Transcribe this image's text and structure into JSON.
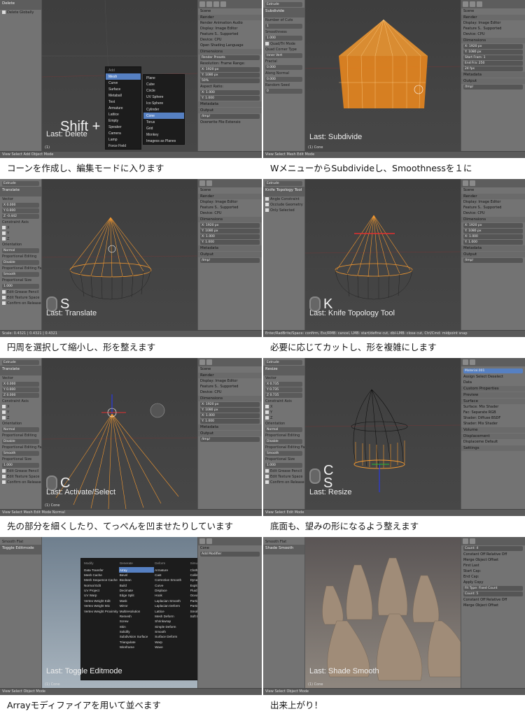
{
  "captions": [
    "コーンを作成し、編集モードに入ります",
    "WメニューからSubdivideし、Smoothnessを１に",
    "円周を選択して縮小し、形を整えます",
    "必要に応じてカットし、形を複雑にします",
    "先の部分を細くしたり、てっぺんを凹ませたりしています",
    "底面も、望みの形になるよう整えます",
    "Arrayモディファイアを用いて並べます",
    "出来上がり！"
  ],
  "panels": [
    {
      "last": "Last: Delete",
      "key": "Shift +",
      "left_header": "Delete",
      "left_items": [
        "Delete Globally"
      ],
      "obj": "(1)",
      "mode": "Object Mode"
    },
    {
      "last": "Last: Subdivide",
      "key": "",
      "left_header": "Subdivide",
      "left_items": [
        "Number of Cuts",
        "1",
        "Smoothness",
        "1.000",
        "Quad/Tri Mode",
        "Quad Corner Type",
        "Inner Vert",
        "Fractal",
        "0.000",
        "Along Normal",
        "0.000",
        "Random Seed",
        "0"
      ],
      "obj": "(1) Cone",
      "mode": "Edit Mode"
    },
    {
      "last": "Last: Translate",
      "key": "S",
      "left_header": "Translate",
      "left_items": [
        "Vector",
        "X 0.000",
        "Y 0.000",
        "Z -0.442",
        "Constraint Axis",
        "X",
        "Y",
        "Z",
        "Orientation",
        "Normal",
        "Proportional Editing",
        "Disable",
        "Proportional Editing Fall",
        "Smooth",
        "Proportional Size",
        "1.000",
        "Edit Grease Pencil",
        "Edit Texture Space",
        "Confirm on Release"
      ],
      "obj": "(1) Cone",
      "mode": "Edit Mode",
      "status": "Scale: 0.4321 | 0.4321 | 0.4321"
    },
    {
      "last": "Last: Knife Topology Tool",
      "key": "K",
      "left_header": "Knife Topology Tool",
      "left_items": [
        "Angle Constraint",
        "Occlude Geometry",
        "Only Selected"
      ],
      "obj": "(1) Cone",
      "mode": "Edit Mode",
      "status": "Enter/RadBrite/Space: confirm, Esc/RMB: cancel, LMB: start/define cut, dbl-LMB: close cut, Ctrl/Cmd: midpoint snap"
    },
    {
      "last": "Last: Activate/Select",
      "key": "C",
      "left_header": "Translate",
      "left_items": [
        "Vector",
        "X 0.000",
        "Y 0.000",
        "Z 0.000",
        "Constraint Axis",
        "X",
        "Y",
        "Z",
        "Orientation",
        "Normal",
        "Proportional Editing",
        "Disable",
        "Proportional Editing Fall",
        "Smooth",
        "Proportional Size",
        "1.000",
        "Edit Grease Pencil",
        "Edit Texture Space",
        "Confirm on Release"
      ],
      "obj": "(1) Cone",
      "mode": "Edit Mode"
    },
    {
      "last": "Last: Resize",
      "key": "C\nS",
      "left_header": "Resize",
      "left_items": [
        "Vector",
        "X 0.735",
        "Y 0.735",
        "Z 0.735",
        "Constraint Axis",
        "X",
        "Y",
        "Z",
        "Orientation",
        "Normal",
        "Proportional Editing",
        "Disable",
        "Proportional Editing Fall",
        "Smooth",
        "Proportional Size",
        "1.000",
        "Edit Grease Pencil",
        "Edit Texture Space",
        "Confirm on Release"
      ],
      "obj": "(1) Cone",
      "mode": "Edit Mode"
    },
    {
      "last": "Last: Toggle Editmode",
      "key": "",
      "left_header": "Toggle Editmode",
      "left_items": [],
      "obj": "(1) Cone",
      "mode": "Object Mode"
    },
    {
      "last": "Last: Shade Smooth",
      "key": "",
      "left_header": "Shade Smooth",
      "left_items": [],
      "obj": "(1) Cone",
      "mode": "Object Mode"
    }
  ],
  "props": {
    "scene": "Scene",
    "render": "Render",
    "tabs": [
      "Render",
      "Animation",
      "Audio"
    ],
    "display_label": "Display:",
    "display_value": "Image Editor",
    "feature_label": "Feature S..",
    "feature_value": "Supported",
    "device_label": "Device:",
    "device_value": "CPU",
    "osl": "Open Shading Language",
    "dimensions": "Dimensions",
    "presets": "Render Presets",
    "resolution": "Resolution:",
    "res_x": "X: 1920 px",
    "res_y": "Y: 1080 px",
    "res_pct": "50%",
    "frame_range": "Frame Range:",
    "start": "Start Fram: 1",
    "end": "End Fra: 250",
    "step": "Frame Step: 1",
    "aspect": "Aspect Ratio:",
    "asp_x": "X: 1.000",
    "asp_y": "Y: 1.000",
    "frame_rate_label": "Frame Rate:",
    "fps": "24 fps",
    "time_remap": "Time Remapping:",
    "border": "Bor",
    "crop": "Cr",
    "remap_old": "100",
    "remap_new": "100",
    "metadata": "Metadata",
    "output": "Output",
    "tmp": "/tmp/",
    "overwrite": "Overwrite",
    "file_ext": "File Extensio"
  },
  "menu_add": {
    "title": "Add",
    "items": [
      "Mesh",
      "Curve",
      "Surface",
      "Metaball",
      "Text",
      "Armature",
      "Lattice",
      "Empty",
      "Speaker",
      "Camera",
      "Lamp",
      "Force Field"
    ],
    "sub": [
      "Plane",
      "Cube",
      "Circle",
      "UV Sphere",
      "Ico Sphere",
      "Cylinder",
      "Cone",
      "Torus",
      "Grid",
      "Monkey",
      "Imagess as Planes"
    ]
  },
  "material": {
    "name": "Material.001",
    "assign": "Assign",
    "select": "Select",
    "deselect": "Deselect",
    "data": "Data",
    "custom": "Custom Properties",
    "preview": "Preview",
    "surface": "Surface",
    "surface_label": "Surface:",
    "surface_value": "Mix Shader",
    "fac": "Fac:",
    "fac_value": "Separate RGB",
    "shader": "Shader:",
    "shader1": "Diffuse BSDF",
    "shader2": "Mix Shader",
    "volume": "Volume",
    "displacement": "Displacement",
    "displace": "Displaceme",
    "disp_value": "Default",
    "settings": "Settings"
  },
  "modifier_menu": {
    "add_modifier": "Add Modifier",
    "obj": "Cone",
    "cols": [
      {
        "h": "Modify",
        "items": [
          "Data Transfer",
          "Mesh Cache",
          "Mesh Sequence Cache",
          "Normal Edit",
          "UV Project",
          "UV Warp",
          "Vertex Weight Edit",
          "Vertex Weight Mix",
          "Vertex Weight Proximity"
        ]
      },
      {
        "h": "Generate",
        "items": [
          "Array",
          "Bevel",
          "Boolean",
          "Build",
          "Decimate",
          "Edge Split",
          "Mask",
          "Mirror",
          "Multiresolution",
          "Remesh",
          "Screw",
          "Skin",
          "Solidify",
          "Subdivision Surface",
          "Triangulate",
          "Wireframe"
        ]
      },
      {
        "h": "Deform",
        "items": [
          "Armature",
          "Cast",
          "Corrective Smooth",
          "Curve",
          "Displace",
          "Hook",
          "Laplacian Smooth",
          "Laplacian Deform",
          "Lattice",
          "Mesh Deform",
          "Shrinkwrap",
          "Simple Deform",
          "Smooth",
          "Surface Deform",
          "Warp",
          "Wave"
        ]
      },
      {
        "h": "Simulate",
        "items": [
          "Cloth",
          "Collision",
          "Dynamic Paint",
          "Explode",
          "Fluid Simulation",
          "Ocean",
          "Particle Instance",
          "Particle System",
          "Smoke",
          "Soft Body"
        ]
      }
    ]
  },
  "array_panel": {
    "count_label": "Count:",
    "count": "4",
    "constant": "Constant Off",
    "relative": "Relative Off",
    "merge": "Merge",
    "object_offset": "Object Offset",
    "first_last": "First Last",
    "start_cap": "Start Cap:",
    "end_cap": "End Cap:",
    "apply": "Apply",
    "copy": "Copy",
    "fit_type": "Fit Type:",
    "fit_value": "Fixed Count",
    "count2": "5"
  },
  "viewport_header": {
    "view": "View",
    "select": "Select",
    "add": "Add",
    "mesh": "Mesh",
    "normal": "Normal"
  },
  "smooth_tab": [
    "Smooth",
    "Flat"
  ],
  "extrude": "Extrude"
}
